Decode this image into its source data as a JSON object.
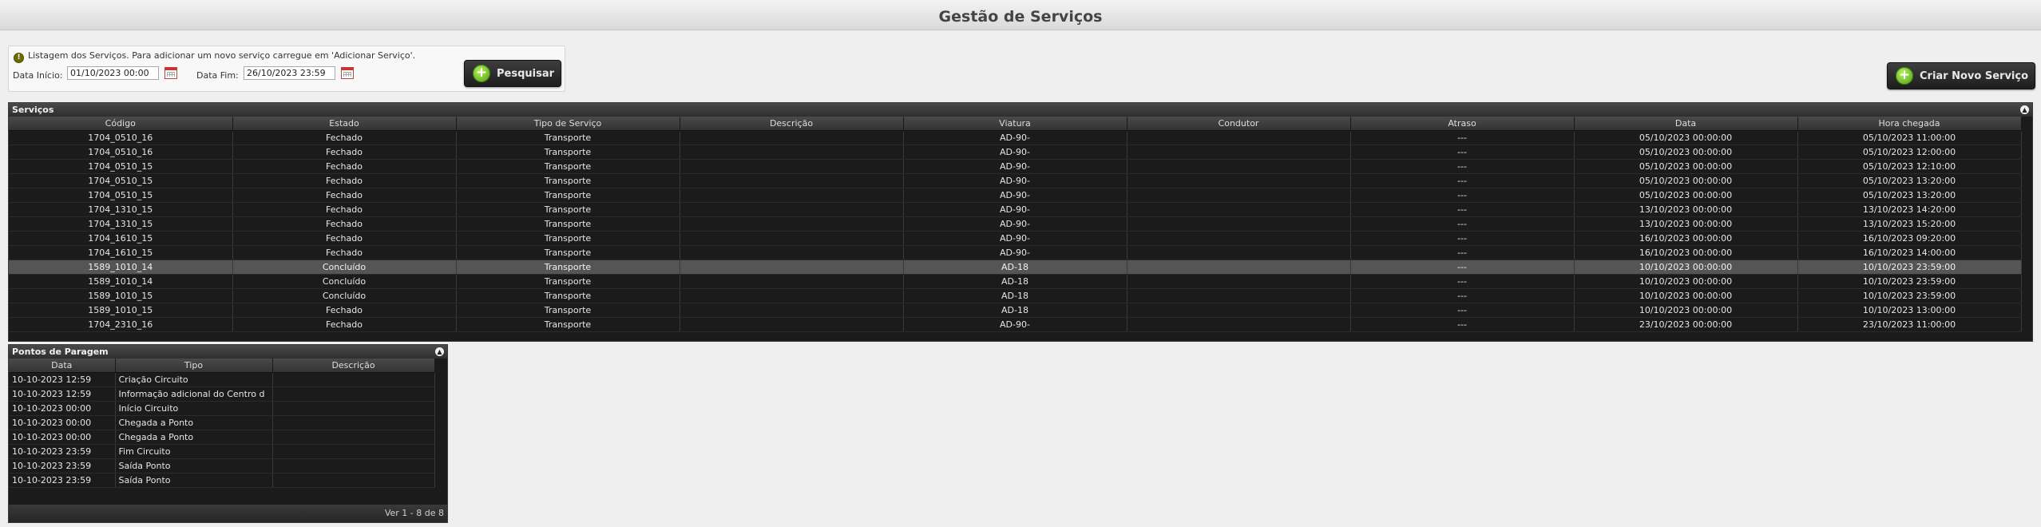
{
  "page": {
    "title": "Gestão de Serviços"
  },
  "filter": {
    "info_text": "Listagem dos Serviços. Para adicionar um novo serviço carregue em 'Adicionar Serviço'.",
    "start_label": "Data Início:",
    "start_value": "01/10/2023 00:00",
    "end_label": "Data Fim:",
    "end_value": "26/10/2023 23:59",
    "search_label": "Pesquisar"
  },
  "create_button_label": "Criar Novo Serviço",
  "services": {
    "title": "Serviços",
    "columns": [
      "Código",
      "Estado",
      "Tipo de Serviço",
      "Descrição",
      "Viatura",
      "Condutor",
      "Atraso",
      "Data",
      "Hora chegada"
    ],
    "rows": [
      [
        "1704_0510_16",
        "Fechado",
        "Transporte",
        "",
        "AD-90-",
        "",
        "---",
        "05/10/2023 00:00:00",
        "05/10/2023 11:00:00"
      ],
      [
        "1704_0510_16",
        "Fechado",
        "Transporte",
        "",
        "AD-90-",
        "",
        "---",
        "05/10/2023 00:00:00",
        "05/10/2023 12:00:00"
      ],
      [
        "1704_0510_15",
        "Fechado",
        "Transporte",
        "",
        "AD-90-",
        "",
        "---",
        "05/10/2023 00:00:00",
        "05/10/2023 12:10:00"
      ],
      [
        "1704_0510_15",
        "Fechado",
        "Transporte",
        "",
        "AD-90-",
        "",
        "---",
        "05/10/2023 00:00:00",
        "05/10/2023 13:20:00"
      ],
      [
        "1704_0510_15",
        "Fechado",
        "Transporte",
        "",
        "AD-90-",
        "",
        "---",
        "05/10/2023 00:00:00",
        "05/10/2023 13:20:00"
      ],
      [
        "1704_1310_15",
        "Fechado",
        "Transporte",
        "",
        "AD-90-",
        "",
        "---",
        "13/10/2023 00:00:00",
        "13/10/2023 14:20:00"
      ],
      [
        "1704_1310_15",
        "Fechado",
        "Transporte",
        "",
        "AD-90-",
        "",
        "---",
        "13/10/2023 00:00:00",
        "13/10/2023 15:20:00"
      ],
      [
        "1704_1610_15",
        "Fechado",
        "Transporte",
        "",
        "AD-90-",
        "",
        "---",
        "16/10/2023 00:00:00",
        "16/10/2023 09:20:00"
      ],
      [
        "1704_1610_15",
        "Fechado",
        "Transporte",
        "",
        "AD-90-",
        "",
        "---",
        "16/10/2023 00:00:00",
        "16/10/2023 14:00:00"
      ],
      [
        "1589_1010_14",
        "Concluído",
        "Transporte",
        "",
        "AD-18",
        "",
        "---",
        "10/10/2023 00:00:00",
        "10/10/2023 23:59:00"
      ],
      [
        "1589_1010_14",
        "Concluído",
        "Transporte",
        "",
        "AD-18",
        "",
        "---",
        "10/10/2023 00:00:00",
        "10/10/2023 23:59:00"
      ],
      [
        "1589_1010_15",
        "Concluído",
        "Transporte",
        "",
        "AD-18",
        "",
        "---",
        "10/10/2023 00:00:00",
        "10/10/2023 23:59:00"
      ],
      [
        "1589_1010_15",
        "Fechado",
        "Transporte",
        "",
        "AD-18",
        "",
        "---",
        "10/10/2023 00:00:00",
        "10/10/2023 13:00:00"
      ],
      [
        "1704_2310_16",
        "Fechado",
        "Transporte",
        "",
        "AD-90-",
        "",
        "---",
        "23/10/2023 00:00:00",
        "23/10/2023 11:00:00"
      ]
    ],
    "selected_row": 9
  },
  "stops": {
    "title": "Pontos de Paragem",
    "columns": [
      "Data",
      "Tipo",
      "Descrição"
    ],
    "rows": [
      [
        "10-10-2023 12:59",
        "Criação Circuito",
        ""
      ],
      [
        "10-10-2023 12:59",
        "Informação adicional do Centro d",
        ""
      ],
      [
        "10-10-2023 00:00",
        "Início Circuito",
        ""
      ],
      [
        "10-10-2023 00:00",
        "Chegada a Ponto",
        ""
      ],
      [
        "10-10-2023 00:00",
        "Chegada a Ponto",
        ""
      ],
      [
        "10-10-2023 23:59",
        "Fim Circuito",
        ""
      ],
      [
        "10-10-2023 23:59",
        "Saída Ponto",
        ""
      ],
      [
        "10-10-2023 23:59",
        "Saída Ponto",
        ""
      ]
    ],
    "footer": "Ver 1 - 8 de 8"
  }
}
